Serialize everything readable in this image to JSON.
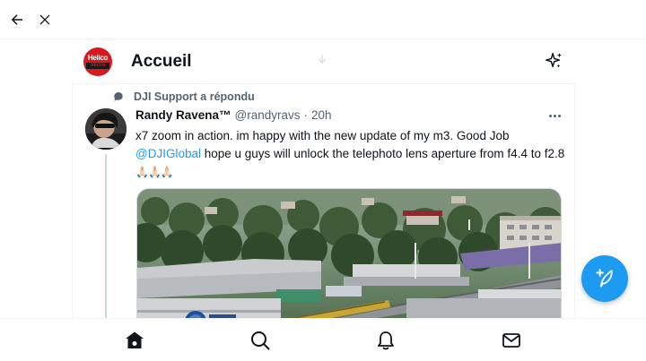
{
  "header": {
    "title": "Accueil",
    "logo": {
      "line1": "Helico",
      "line2": "micro"
    }
  },
  "tweet": {
    "reply_context": "DJI Support a répondu",
    "author_name": "Randy Ravena™",
    "author_handle": "@randyravs",
    "separator": "·",
    "time": "20h",
    "text_part1": "x7 zoom in action. im happy with the new update of my m3.  Good Job ",
    "mention": "@DJIGlobal",
    "text_part2": " hope u guys will unlock the telephoto lens aperture from f4.4 to f2.8 ",
    "emojis": "🙏🏻🙏🏻🙏🏻"
  },
  "icons": {
    "back": "arrow-left-icon",
    "close": "close-icon",
    "sparkle": "sparkle-icon",
    "compose": "feather-plus-icon",
    "home": "home-icon",
    "search": "search-icon",
    "notifications": "bell-icon",
    "messages": "mail-icon"
  },
  "colors": {
    "accent": "#1d9bf0",
    "text": "#0f1419",
    "muted": "#536471",
    "logo_red": "#d71920"
  }
}
